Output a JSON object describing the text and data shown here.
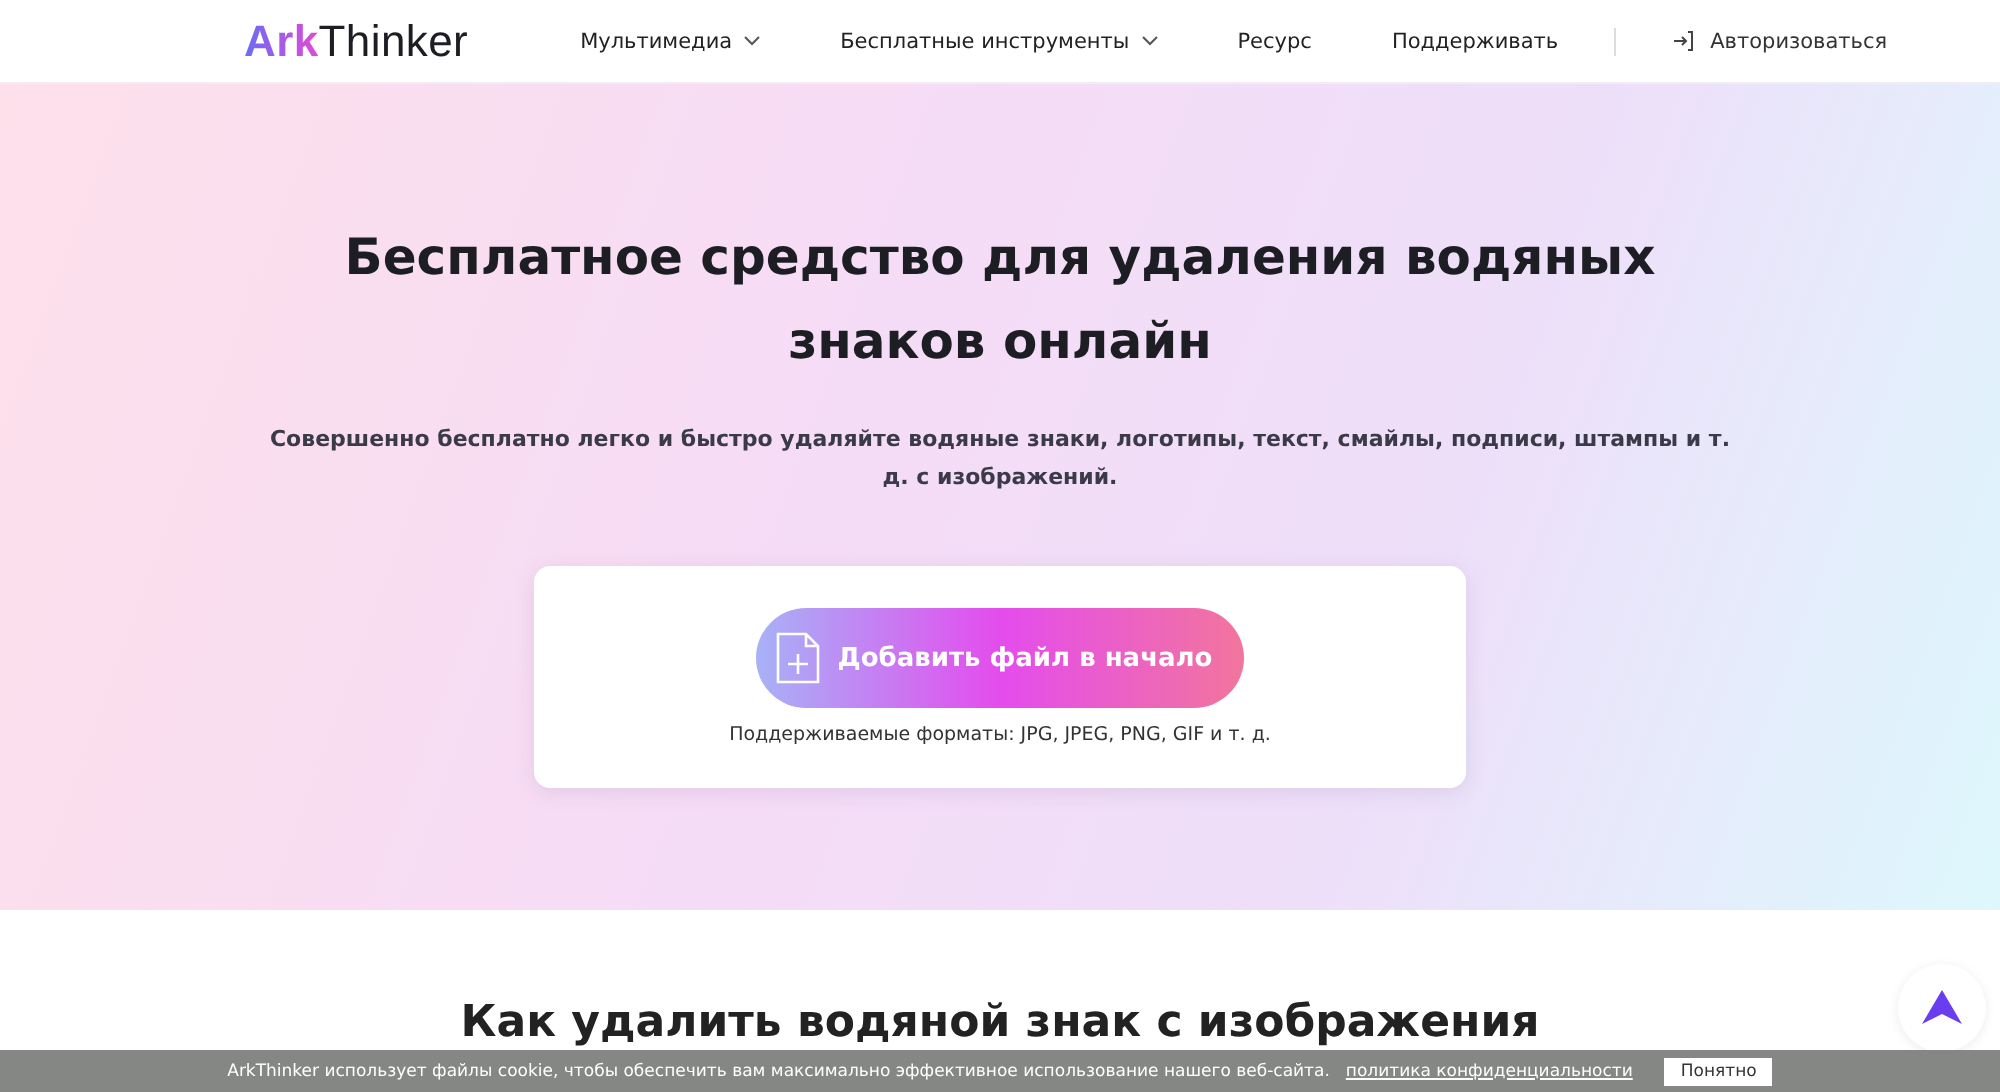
{
  "header": {
    "logo": {
      "accent": "Ark",
      "text": "Thinker"
    },
    "nav": [
      {
        "label": "Мультимедиа",
        "dropdown": true
      },
      {
        "label": "Бесплатные инструменты",
        "dropdown": true
      },
      {
        "label": "Ресурс",
        "dropdown": false
      },
      {
        "label": "Поддерживать",
        "dropdown": false
      }
    ],
    "login": "Авторизоваться"
  },
  "hero": {
    "title": "Бесплатное средство для удаления водяных знаков онлайн",
    "subtitle": "Совершенно бесплатно легко и быстро удаляйте водяные знаки, логотипы, текст, смайлы, подписи, штампы и т. д. с изображений.",
    "upload_button": "Добавить файл в начало",
    "formats": "Поддерживаемые форматы: JPG, JPEG, PNG, GIF и т. д."
  },
  "section": {
    "title": "Как удалить водяной знак с изображения"
  },
  "cookie_bar": {
    "text": "ArkThinker использует файлы cookie, чтобы обеспечить вам максимально эффективное использование нашего веб-сайта.",
    "link": "политика конфиденциальности",
    "button": "Понятно"
  }
}
